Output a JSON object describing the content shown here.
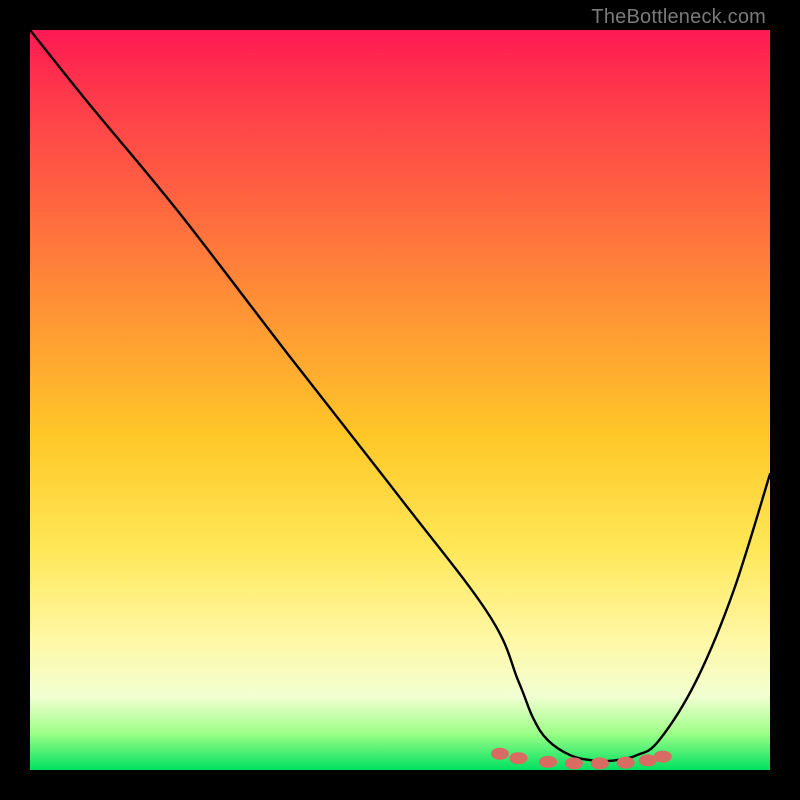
{
  "attribution": "TheBottleneck.com",
  "chart_data": {
    "type": "line",
    "title": "",
    "xlabel": "",
    "ylabel": "",
    "xlim": [
      0,
      100
    ],
    "ylim": [
      0,
      100
    ],
    "grid": false,
    "legend": false,
    "series": [
      {
        "name": "curve",
        "x": [
          0,
          8,
          20,
          35,
          50,
          62,
          66,
          68,
          70,
          73,
          76,
          79,
          82,
          85,
          90,
          95,
          100
        ],
        "values": [
          100,
          90,
          75.5,
          56,
          36.8,
          21,
          12,
          7,
          4,
          2,
          1.3,
          1.3,
          2,
          4,
          12,
          24,
          40
        ],
        "color": "#000000"
      },
      {
        "name": "marker-dots",
        "x": [
          63.5,
          66,
          70,
          73.5,
          77,
          80.5,
          83.5,
          85.5
        ],
        "values": [
          2.2,
          1.6,
          1.1,
          0.9,
          0.9,
          1.0,
          1.3,
          1.8
        ],
        "color": "#d96b63"
      }
    ],
    "bottom_band": {
      "y_from": 0,
      "y_to": 3,
      "color": "#00e060"
    }
  }
}
